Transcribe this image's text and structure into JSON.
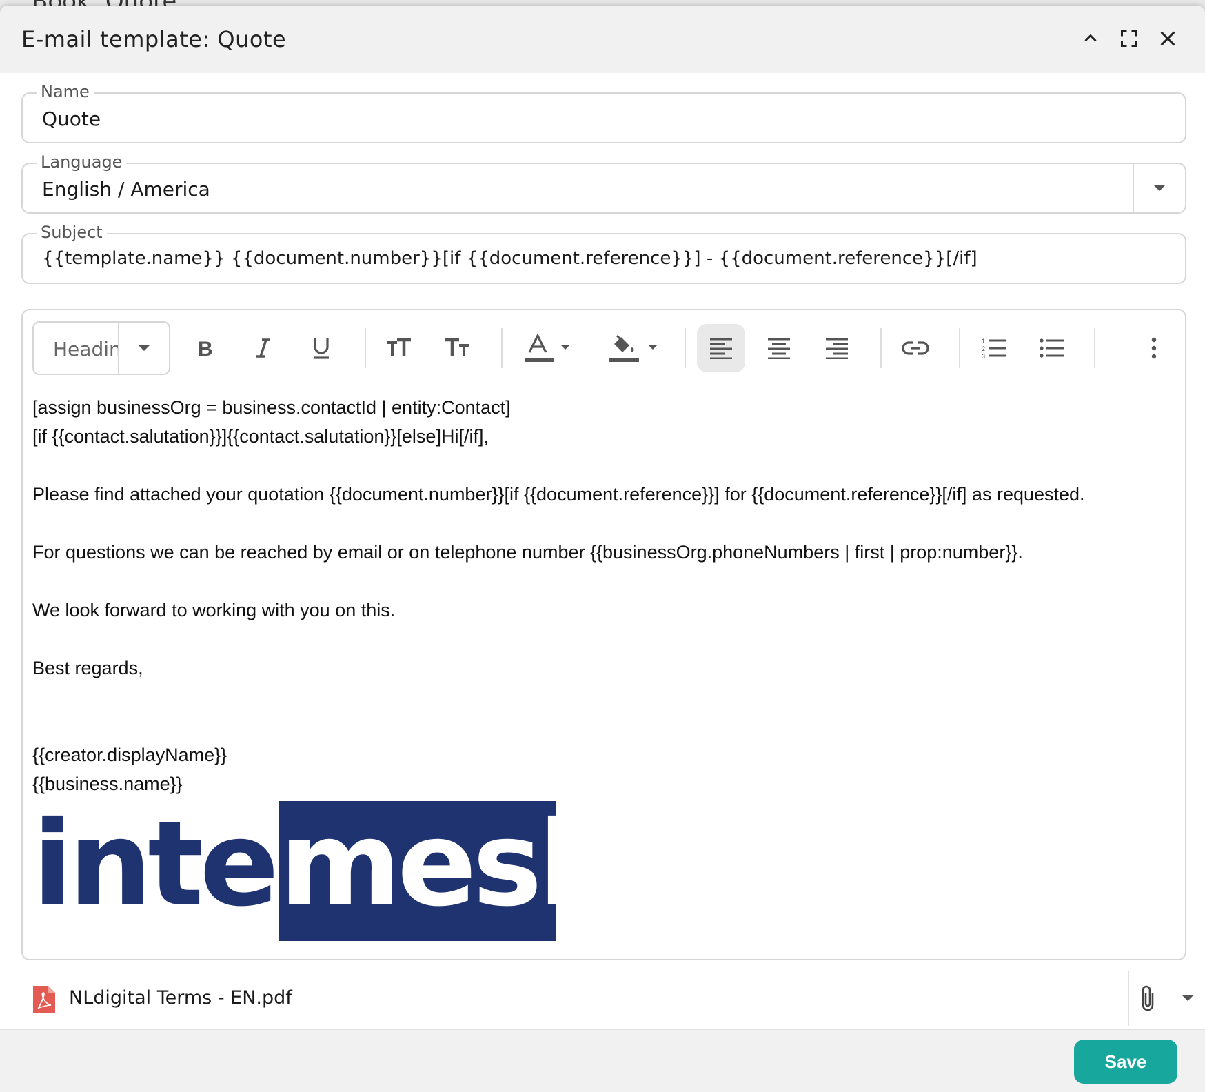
{
  "background_window": {
    "title": "Book: Quote"
  },
  "dialog": {
    "title": "E-mail template: Quote",
    "buttons": {
      "collapse": "chevron-up-icon",
      "maximize": "fullscreen-icon",
      "close": "close-icon"
    }
  },
  "fields": {
    "name": {
      "label": "Name",
      "value": "Quote"
    },
    "language": {
      "label": "Language",
      "value": "English / America"
    },
    "subject": {
      "label": "Subject",
      "value": "{{template.name}} {{document.number}}[if {{document.reference}}] - {{document.reference}}[/if]"
    }
  },
  "toolbar": {
    "heading_select": "Headin",
    "tools": [
      "bold-icon",
      "italic-icon",
      "underline-icon",
      "font-size-increase-icon",
      "font-size-decrease-icon",
      "text-color-icon",
      "fill-color-icon",
      "align-left-icon",
      "align-center-icon",
      "align-right-icon",
      "link-icon",
      "ordered-list-icon",
      "bullet-list-icon",
      "more-vert-icon"
    ],
    "active_tool": "align-left-icon"
  },
  "body": {
    "line1": "[assign businessOrg = business.contactId | entity:Contact]",
    "line2": "[if {{contact.salutation}}]{{contact.salutation}}[else]Hi[/if],",
    "line3": "Please find attached your quotation {{document.number}}[if {{document.reference}}] for {{document.reference}}[/if] as requested.",
    "line4": "For questions we can be reached by email or on telephone number {{businessOrg.phoneNumbers | first | prop:number}}.",
    "line5": "We look forward to working with you on this.",
    "line6": "Best regards,",
    "line7": "{{creator.displayName}}",
    "line8": "{{business.name}}"
  },
  "logo": {
    "part1": "inter",
    "part2": "mesh",
    "colors": {
      "navy": "#1f3370",
      "white": "#ffffff"
    }
  },
  "attachment": {
    "filename": "NLdigital Terms - EN.pdf",
    "icon": "pdf-icon"
  },
  "footer": {
    "save_label": "Save"
  },
  "colors": {
    "accent": "#17a79d",
    "pdf": "#e35b52"
  }
}
